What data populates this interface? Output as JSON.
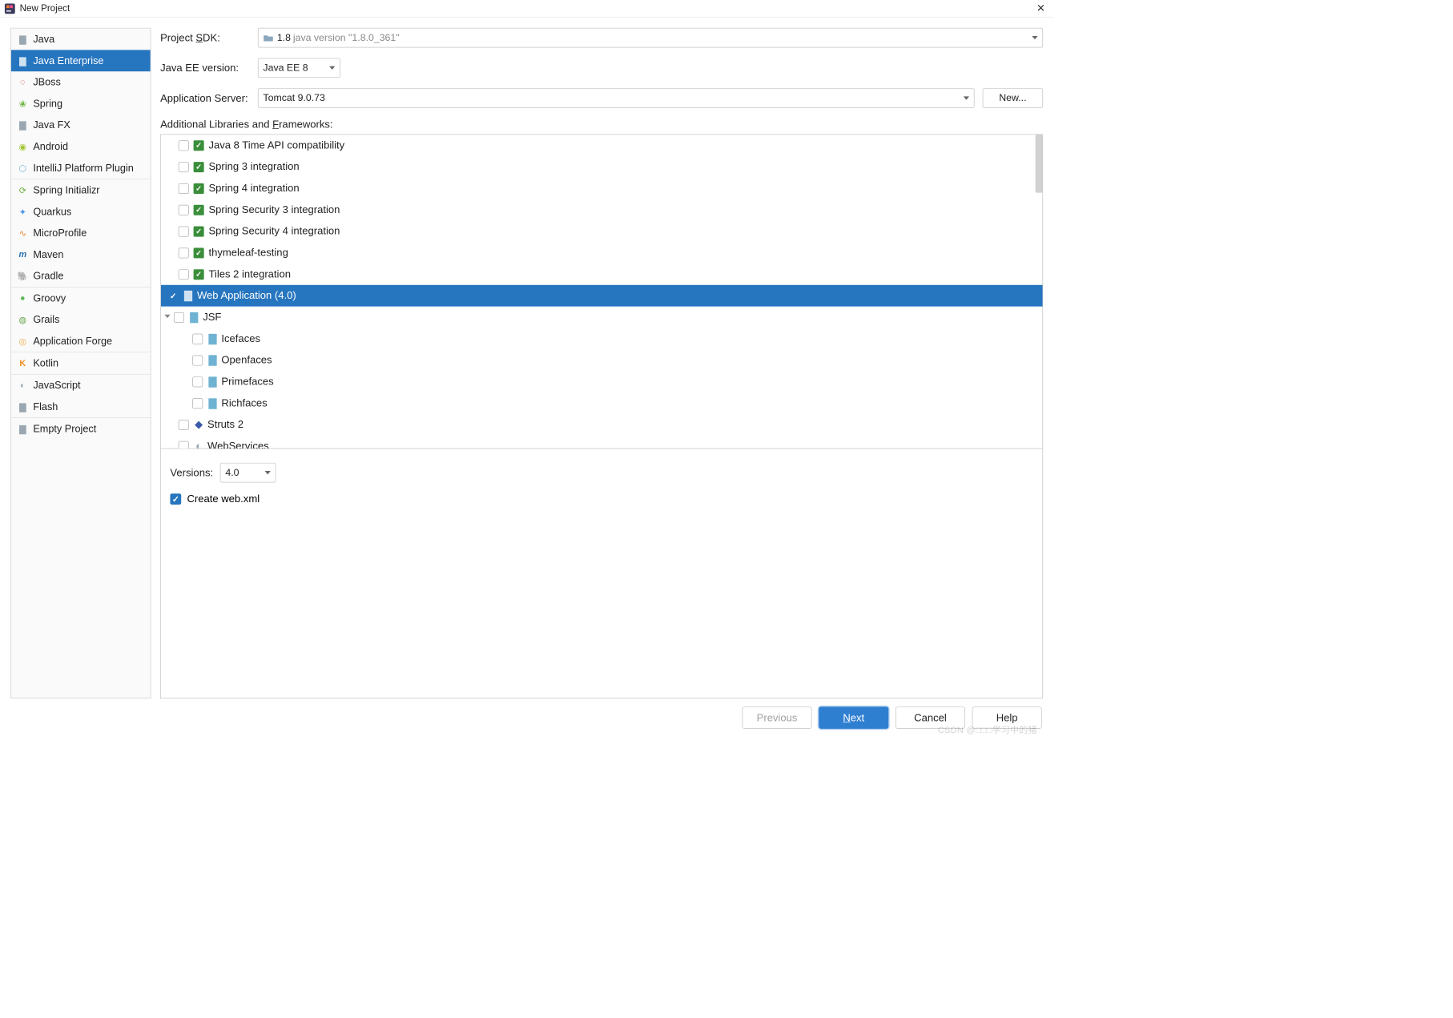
{
  "window": {
    "title": "New Project"
  },
  "left": {
    "groups": [
      [
        "Java",
        "Java Enterprise",
        "JBoss",
        "Spring",
        "Java FX",
        "Android",
        "IntelliJ Platform Plugin"
      ],
      [
        "Spring Initializr",
        "Quarkus",
        "MicroProfile",
        "Maven",
        "Gradle"
      ],
      [
        "Groovy",
        "Grails",
        "Application Forge"
      ],
      [
        "Kotlin"
      ],
      [
        "JavaScript",
        "Flash"
      ],
      [
        "Empty Project"
      ]
    ],
    "selected": "Java Enterprise"
  },
  "form": {
    "sdk_label_pre": "Project ",
    "sdk_label_u": "S",
    "sdk_label_post": "DK:",
    "sdk_name": "1.8",
    "sdk_version": "java version \"1.8.0_361\"",
    "ee_label": "Java EE version:",
    "ee_value": "Java EE 8",
    "app_label": "Application Server:",
    "app_value": "Tomcat 9.0.73",
    "new_btn": "New...",
    "libs_label_pre": "Additional Libraries and ",
    "libs_label_u": "F",
    "libs_label_post": "rameworks:"
  },
  "tree": {
    "items": [
      {
        "label": "Java 8 Time API compatibility",
        "type": "green",
        "checked": false,
        "depth": 1
      },
      {
        "label": "Spring 3 integration",
        "type": "green",
        "checked": false,
        "depth": 1
      },
      {
        "label": "Spring 4 integration",
        "type": "green",
        "checked": false,
        "depth": 1
      },
      {
        "label": "Spring Security 3 integration",
        "type": "green",
        "checked": false,
        "depth": 1
      },
      {
        "label": "Spring Security 4 integration",
        "type": "green",
        "checked": false,
        "depth": 1
      },
      {
        "label": "thymeleaf-testing",
        "type": "green",
        "checked": false,
        "depth": 1
      },
      {
        "label": "Tiles 2 integration",
        "type": "green",
        "checked": false,
        "depth": 1
      },
      {
        "label": "Web Application (4.0)",
        "type": "web",
        "checked": true,
        "depth": 0,
        "selected": true
      },
      {
        "label": "JSF",
        "type": "fw",
        "checked": false,
        "depth": 0,
        "disclosure": "open"
      },
      {
        "label": "Icefaces",
        "type": "fw",
        "checked": false,
        "depth": 2
      },
      {
        "label": "Openfaces",
        "type": "fw",
        "checked": false,
        "depth": 2
      },
      {
        "label": "Primefaces",
        "type": "fw",
        "checked": false,
        "depth": 2
      },
      {
        "label": "Richfaces",
        "type": "fw",
        "checked": false,
        "depth": 2
      },
      {
        "label": "Struts 2",
        "type": "struts",
        "checked": false,
        "depth": 1
      },
      {
        "label": "WebServices",
        "type": "ws",
        "checked": false,
        "depth": 1
      }
    ]
  },
  "options": {
    "versions_label": "Versions:",
    "versions_value": "4.0",
    "create_webxml_label": "Create web.xml",
    "create_webxml_checked": true
  },
  "footer": {
    "previous": "Previous",
    "next_u": "N",
    "next_rest": "ext",
    "cancel": "Cancel",
    "help": "Help"
  },
  "watermark": "CSDN @□□□学习中的猪"
}
